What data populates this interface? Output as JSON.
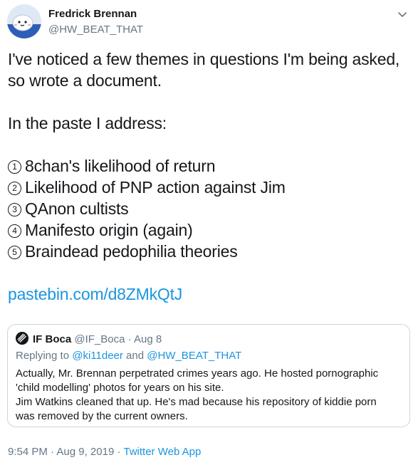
{
  "tweet": {
    "author_name": "Fredrick Brennan",
    "author_handle": "@HW_BEAT_THAT",
    "body_lines": [
      "I've noticed a few themes in questions I'm being asked,",
      "so wrote a document.",
      "",
      "In the paste I address:",
      ""
    ],
    "list": [
      {
        "num": "1",
        "text": "8chan's likelihood of return"
      },
      {
        "num": "2",
        "text": "Likelihood of PNP action against Jim"
      },
      {
        "num": "3",
        "text": "QAnon cultists"
      },
      {
        "num": "4",
        "text": "Manifesto origin (again)"
      },
      {
        "num": "5",
        "text": "Braindead pedophilia theories"
      }
    ],
    "link": "pastebin.com/d8ZMkQtJ",
    "link_color": "#1b95e0"
  },
  "quoted": {
    "name": "IF Boca",
    "handle": "@IF_Boca",
    "separator": "·",
    "date": "Aug 8",
    "reply_prefix": "Replying to",
    "reply_mention_1": "@ki11deer",
    "reply_and": "and",
    "reply_mention_2": "@HW_BEAT_THAT",
    "body_lines": [
      "Actually, Mr. Brennan perpetrated crimes years ago. He hosted pornographic",
      "'child modelling' photos for years on his site.",
      "Jim Watkins cleaned that up. He's mad because his repository of kiddie porn",
      "was removed by the current owners."
    ]
  },
  "footer": {
    "time": "9:54 PM",
    "separator": "·",
    "date": "Aug 9, 2019",
    "separator2": "·",
    "source": "Twitter Web App"
  },
  "icons": {
    "avatar": "cartoon-avatar",
    "more": "chevron-down-icon",
    "quoted_avatar": "circle-logo-avatar"
  }
}
